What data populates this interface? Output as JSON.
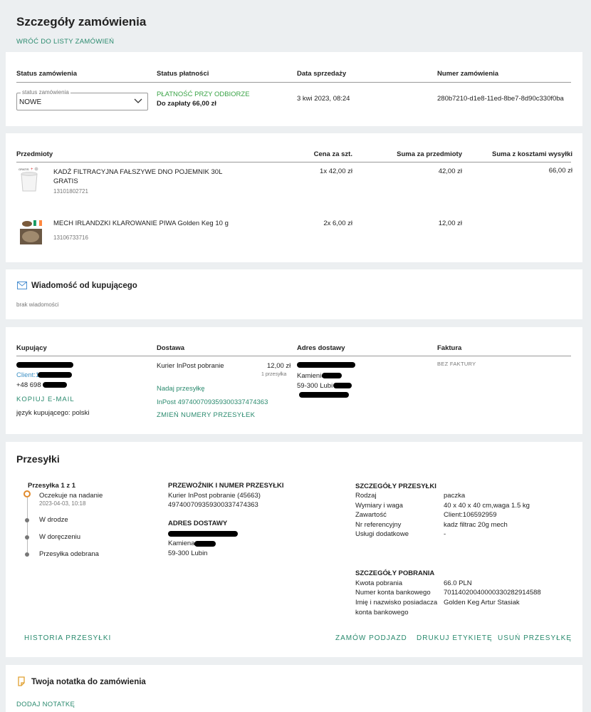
{
  "page": {
    "title": "Szczegóły zamówienia",
    "back_link": "WRÓĆ DO LISTY ZAMÓWIEŃ"
  },
  "status": {
    "headers": [
      "Status zamówienia",
      "Status płatności",
      "Data sprzedaży",
      "Numer zamówienia"
    ],
    "select_label": "status zamówienia",
    "select_value": "NOWE",
    "payment_status": "PŁATNOŚĆ PRZY ODBIORZE",
    "to_pay": "Do zapłaty 66,00 zł",
    "sale_date": "3 kwi 2023, 08:24",
    "order_number": "280b7210-d1e8-11ed-8be7-8d90c330f0ba"
  },
  "items": {
    "headers": [
      "Przedmioty",
      "Cena za szt.",
      "Suma za przedmioty",
      "Suma z kosztami wysyłki"
    ],
    "rows": [
      {
        "name": "KADŹ FILTRACYJNA FAŁSZYWE DNO POJEMNIK 30L",
        "name2": "GRATIS",
        "code": "13101802721",
        "price": "1x 42,00 zł",
        "sum": "42,00 zł",
        "total": "66,00 zł"
      },
      {
        "name": "MECH IRLANDZKI KLAROWANIE PIWA Golden Keg 10 g",
        "name2": "",
        "code": "13106733716",
        "price": "2x 6,00 zł",
        "sum": "12,00 zł",
        "total": ""
      }
    ]
  },
  "message": {
    "title": "Wiadomość od kupującego",
    "body": "brak wiadomości"
  },
  "buyer": {
    "headers": [
      "Kupujący",
      "Dostawa",
      "Adres dostawy",
      "Faktura"
    ],
    "client_prefix": "Client:1",
    "phone_prefix": "+48 698",
    "copy_email": "KOPIUJ E-MAIL",
    "language": "język kupującego: polski",
    "delivery_method": "Kurier InPost pobranie",
    "delivery_price": "12,00 zł",
    "delivery_count": "1 przesyłka",
    "send_parcel": "Nadaj przesyłkę",
    "tracking": "InPost 497400709359300337474363",
    "change_numbers": "ZMIEŃ NUMERY PRZESYŁEK",
    "address_city_prefix": "Kamienie",
    "address_zip_prefix": "59-300 Lubi",
    "invoice": "BEZ FAKTURY"
  },
  "shipments": {
    "title": "Przesyłki",
    "shipment_label": "Przesyłka 1 z 1",
    "timeline": [
      {
        "label": "Oczekuje na nadanie",
        "date": "2023-04-03, 10:18"
      },
      {
        "label": "W drodze",
        "date": ""
      },
      {
        "label": "W doręczeniu",
        "date": ""
      },
      {
        "label": "Przesyłka odebrana",
        "date": ""
      }
    ],
    "carrier_header": "PRZEWOŹNIK I NUMER PRZESYŁKI",
    "carrier_name": "Kurier InPost pobranie (45663)",
    "carrier_number": "497400709359300337474363",
    "address_header": "ADRES DOSTAWY",
    "address_city": "Kamiena",
    "address_zip": "59-300 Lubin",
    "details_header": "SZCZEGÓŁY PRZESYŁKI",
    "details": [
      {
        "k": "Rodzaj",
        "v": "paczka"
      },
      {
        "k": "Wymiary i waga",
        "v": "40 x 40 x 40 cm,waga 1.5 kg"
      },
      {
        "k": "Zawartość",
        "v": "Client:106592959"
      },
      {
        "k": "Nr referencyjny",
        "v": "kadz filtrac 20g mech"
      },
      {
        "k": "Usługi dodatkowe",
        "v": "-"
      }
    ],
    "cod_header": "SZCZEGÓŁY POBRANIA",
    "cod": [
      {
        "k": "Kwota pobrania",
        "v": "66.0 PLN"
      },
      {
        "k": "Numer konta bankowego",
        "v": "70114020040000330282914588"
      },
      {
        "k": "Imię i nazwisko posiadacza",
        "v": "Golden Keg Artur Stasiak"
      },
      {
        "k": "konta bankowego",
        "v": ""
      }
    ],
    "history": "HISTORIA PRZESYŁKI",
    "order_pickup": "ZAMÓW PODJAZD",
    "print_label": "DRUKUJ ETYKIETĘ",
    "delete_parcel": "USUŃ PRZESYŁKĘ"
  },
  "note": {
    "title": "Twoja notatka do zamówienia",
    "add": "DODAJ NOTATKĘ"
  },
  "colors": {
    "accent": "#2a8a6e",
    "payment_green": "#3aa346",
    "timeline_active": "#e08a2c",
    "background": "#eceff1"
  }
}
